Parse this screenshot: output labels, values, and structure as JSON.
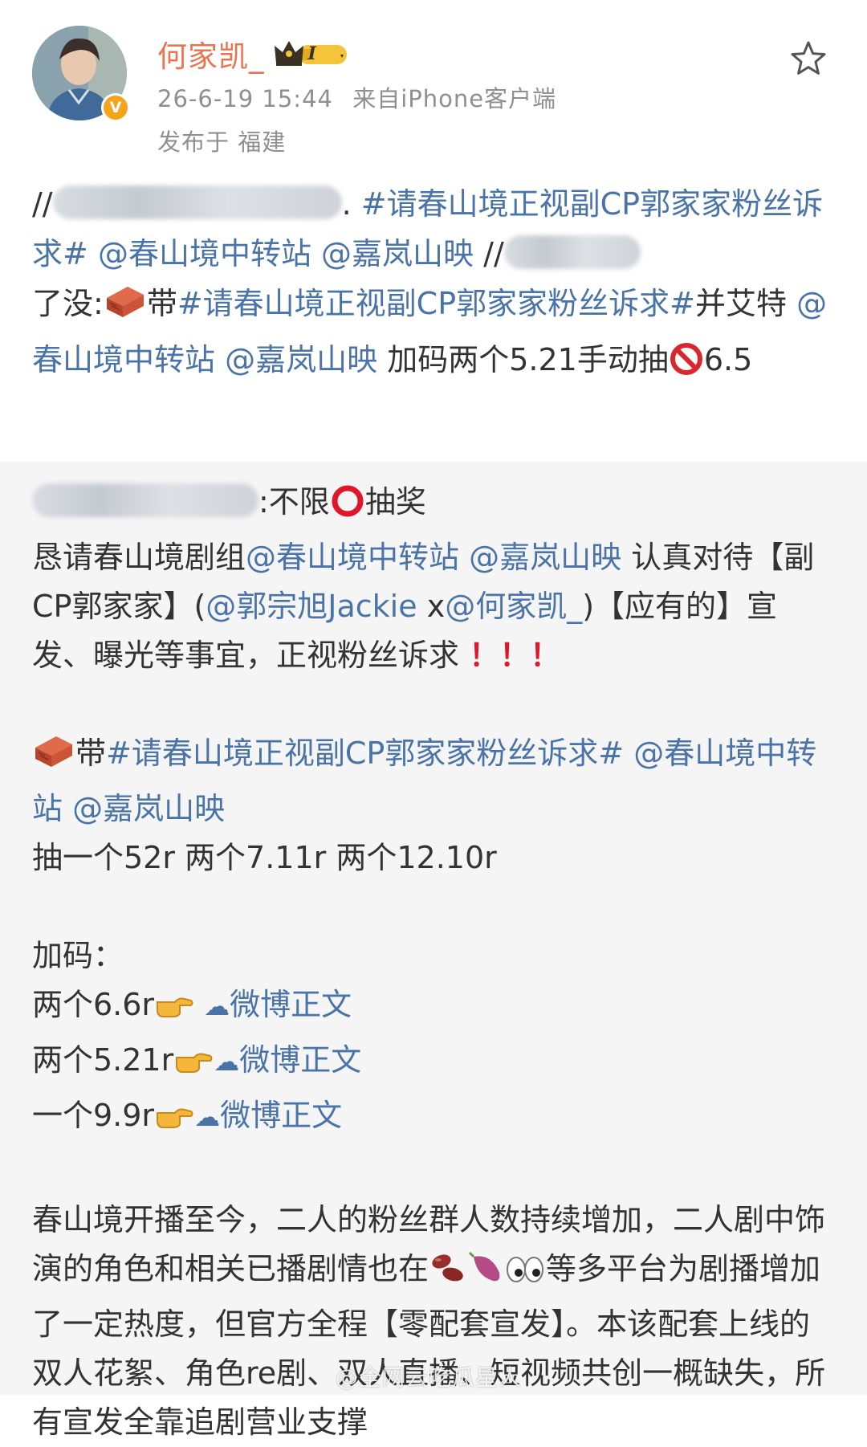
{
  "post": {
    "username": "何家凯_",
    "vip_level": "I",
    "timestamp": "26-6-19 15:44",
    "source": "来自iPhone客户端",
    "location": "发布于 福建"
  },
  "repost": {
    "prefix": "//",
    "sep1": ". ",
    "topic": "#请春山境正视副CP郭家家粉丝诉求#",
    "mention1": "@春山境中转站",
    "mention2": "@嘉岚山映",
    "sep2": " //",
    "text1": "了没:",
    "text2": "带",
    "text3": "并艾特",
    "text4": "加码两个5.21手动抽",
    "text5": "6.5"
  },
  "original": {
    "line1": ":不限",
    "line1_end": "抽奖",
    "p1_a": "恳请春山境剧组",
    "p1_b": "认真对待【副CP郭家家】(",
    "mention3": "@郭宗旭Jackie",
    "p1_x": " x",
    "mention4": "@何家凯_",
    "p1_c": ")【应有的】宣发、曝光等事宜，正视粉丝诉求",
    "red_marks": "！！！",
    "p2_a": "带",
    "p2_c": "抽一个52r 两个7.11r 两个12.10r",
    "jiama": "加码：",
    "bonus": [
      {
        "text": "两个6.6r",
        "link": "微博正文"
      },
      {
        "text": "两个5.21r",
        "link": "微博正文"
      },
      {
        "text": "一个9.9r",
        "link": "微博正文"
      }
    ],
    "p3_a": "春山境开播至今，二人的粉丝群人数持续增加，二人剧中饰演的角色和相关已播剧情也在",
    "p3_b": "等多平台为剧播增加了一定热度，但官方全程【零配套宣发】。本该配套上线的双人花絮、角色re剧、双人直播、短视频共创一概缺失，所有宣发全靠追剧营业支撑",
    "watermark": "@全网云吃瓜星人"
  },
  "colors": {
    "username": "#eb7350",
    "link": "#4a74a8",
    "meta": "#8f8f8f",
    "original_bg": "#f5f5f6",
    "red": "#e0172b"
  },
  "icons": {
    "star": "star-outline-icon",
    "verified": "verified-v-icon",
    "vip": "crown-vip-icon",
    "brick": "brick-emoji",
    "no_entry": "prohibited-emoji",
    "circle": "hollow-red-circle-emoji",
    "pointing": "pointing-right-emoji",
    "weibo": "weibo-link-icon"
  }
}
